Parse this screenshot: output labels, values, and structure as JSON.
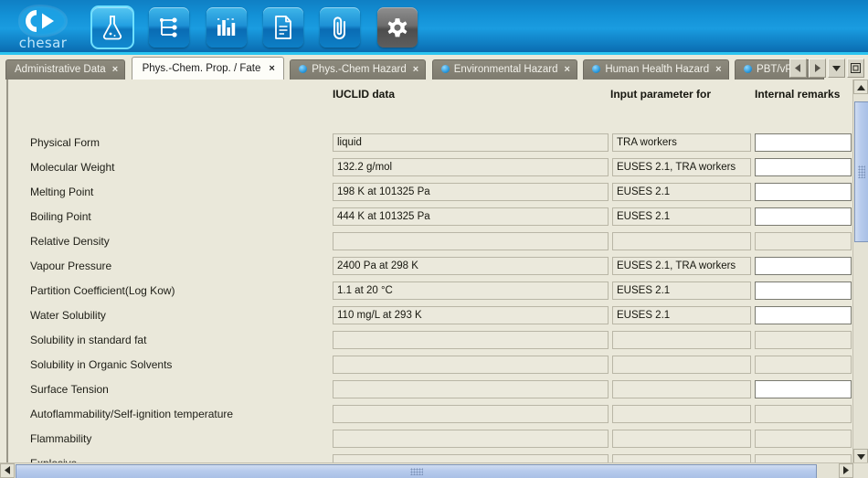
{
  "app": {
    "brand": "chesar",
    "logo_icon": "chesar-play-logo"
  },
  "toolbar": {
    "buttons": [
      {
        "name": "substance-icon",
        "label": "Substance",
        "state": "selected"
      },
      {
        "name": "hierarchy-tree-icon",
        "label": "Uses / Life cycle tree",
        "state": "normal"
      },
      {
        "name": "bar-chart-icon",
        "label": "Assessment",
        "state": "normal"
      },
      {
        "name": "document-icon",
        "label": "Report",
        "state": "normal"
      },
      {
        "name": "paperclip-icon",
        "label": "Attachments",
        "state": "normal"
      },
      {
        "name": "gear-icon",
        "label": "Settings",
        "state": "disabled"
      }
    ]
  },
  "tabs": {
    "items": [
      {
        "label": "Administrative Data",
        "active": false,
        "dot": false,
        "close": "×"
      },
      {
        "label": "Phys.-Chem. Prop. / Fate",
        "active": true,
        "dot": false,
        "close": "×"
      },
      {
        "label": "Phys.-Chem Hazard",
        "active": false,
        "dot": true,
        "close": "×"
      },
      {
        "label": "Environmental Hazard",
        "active": false,
        "dot": true,
        "close": "×"
      },
      {
        "label": "Human Health Hazard",
        "active": false,
        "dot": true,
        "close": "×"
      },
      {
        "label": "PBT/vPvB",
        "active": false,
        "dot": true,
        "close": "×"
      }
    ],
    "nav": [
      {
        "name": "tab-scroll-left-button",
        "icon": "triangle-left-icon"
      },
      {
        "name": "tab-scroll-right-button",
        "icon": "triangle-right-icon"
      },
      {
        "name": "tab-list-dropdown-button",
        "icon": "triangle-down-icon"
      },
      {
        "name": "tab-maximize-button",
        "icon": "square-icon"
      }
    ]
  },
  "table": {
    "headers": {
      "iuclid": "IUCLID data",
      "input_parameter": "Input parameter for",
      "internal_remarks": "Internal remarks"
    },
    "rows": [
      {
        "label": "Physical Form",
        "iuclid": "liquid",
        "input": "TRA workers",
        "remarks": "",
        "remarks_editable": true
      },
      {
        "label": "Molecular Weight",
        "iuclid": "132.2 g/mol",
        "input": "EUSES 2.1, TRA workers",
        "remarks": "",
        "remarks_editable": true
      },
      {
        "label": "Melting Point",
        "iuclid": "198 K at 101325 Pa",
        "input": "EUSES 2.1",
        "remarks": "",
        "remarks_editable": true
      },
      {
        "label": "Boiling Point",
        "iuclid": "444 K at 101325 Pa",
        "input": "EUSES 2.1",
        "remarks": "",
        "remarks_editable": true
      },
      {
        "label": "Relative Density",
        "iuclid": "",
        "input": "",
        "remarks": "",
        "remarks_editable": false
      },
      {
        "label": "Vapour Pressure",
        "iuclid": "2400 Pa at 298 K",
        "input": "EUSES 2.1, TRA workers",
        "remarks": "",
        "remarks_editable": true
      },
      {
        "label": "Partition Coefficient(Log Kow)",
        "iuclid": "1.1 at 20 °C",
        "input": "EUSES 2.1",
        "remarks": "",
        "remarks_editable": true
      },
      {
        "label": "Water Solubility",
        "iuclid": "110 mg/L at 293 K",
        "input": "EUSES 2.1",
        "remarks": "",
        "remarks_editable": true
      },
      {
        "label": "Solubility in standard fat",
        "iuclid": "",
        "input": "",
        "remarks": "",
        "remarks_editable": false
      },
      {
        "label": "Solubility in Organic Solvents",
        "iuclid": "",
        "input": "",
        "remarks": "",
        "remarks_editable": false
      },
      {
        "label": "Surface Tension",
        "iuclid": "",
        "input": "",
        "remarks": "",
        "remarks_editable": true
      },
      {
        "label": "Autoflammability/Self-ignition temperature",
        "iuclid": "",
        "input": "",
        "remarks": "",
        "remarks_editable": false
      },
      {
        "label": "Flammability",
        "iuclid": "",
        "input": "",
        "remarks": "",
        "remarks_editable": false
      },
      {
        "label": "Explosive",
        "iuclid": "",
        "input": "",
        "remarks": "",
        "remarks_editable": false
      }
    ]
  },
  "scrollbars": {
    "vertical": {
      "up_icon": "triangle-up-icon",
      "down_icon": "triangle-down-icon"
    },
    "horizontal": {
      "left_icon": "triangle-left-icon",
      "right_icon": "triangle-right-icon"
    }
  },
  "colors": {
    "banner_blue": "#1391d6",
    "accent_cyan": "#2bc4f0",
    "panel_bg": "#EAE8DA",
    "tab_inactive": "#8d8a7d",
    "scroll_thumb": "#b7cbec"
  }
}
